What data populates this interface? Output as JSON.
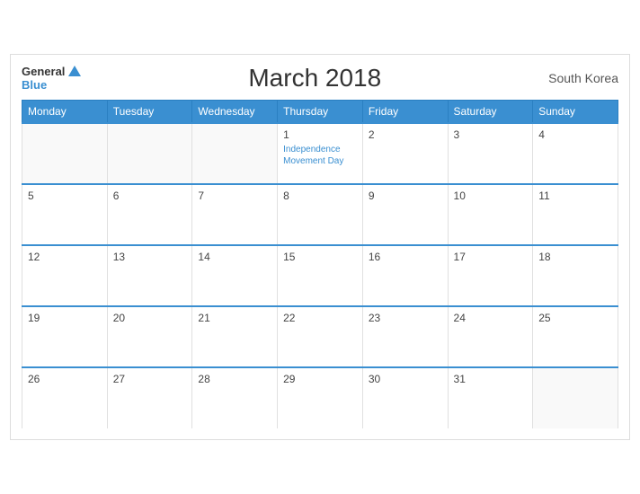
{
  "header": {
    "title": "March 2018",
    "country": "South Korea",
    "logo": {
      "general": "General",
      "blue": "Blue"
    }
  },
  "columns": [
    "Monday",
    "Tuesday",
    "Wednesday",
    "Thursday",
    "Friday",
    "Saturday",
    "Sunday"
  ],
  "weeks": [
    [
      {
        "day": "",
        "empty": true
      },
      {
        "day": "",
        "empty": true
      },
      {
        "day": "",
        "empty": true
      },
      {
        "day": "1",
        "holiday": "Independence Movement Day"
      },
      {
        "day": "2"
      },
      {
        "day": "3"
      },
      {
        "day": "4"
      }
    ],
    [
      {
        "day": "5"
      },
      {
        "day": "6"
      },
      {
        "day": "7"
      },
      {
        "day": "8"
      },
      {
        "day": "9"
      },
      {
        "day": "10"
      },
      {
        "day": "11"
      }
    ],
    [
      {
        "day": "12"
      },
      {
        "day": "13"
      },
      {
        "day": "14"
      },
      {
        "day": "15"
      },
      {
        "day": "16"
      },
      {
        "day": "17"
      },
      {
        "day": "18"
      }
    ],
    [
      {
        "day": "19"
      },
      {
        "day": "20"
      },
      {
        "day": "21"
      },
      {
        "day": "22"
      },
      {
        "day": "23"
      },
      {
        "day": "24"
      },
      {
        "day": "25"
      }
    ],
    [
      {
        "day": "26"
      },
      {
        "day": "27"
      },
      {
        "day": "28"
      },
      {
        "day": "29"
      },
      {
        "day": "30"
      },
      {
        "day": "31"
      },
      {
        "day": "",
        "empty": true
      }
    ]
  ]
}
